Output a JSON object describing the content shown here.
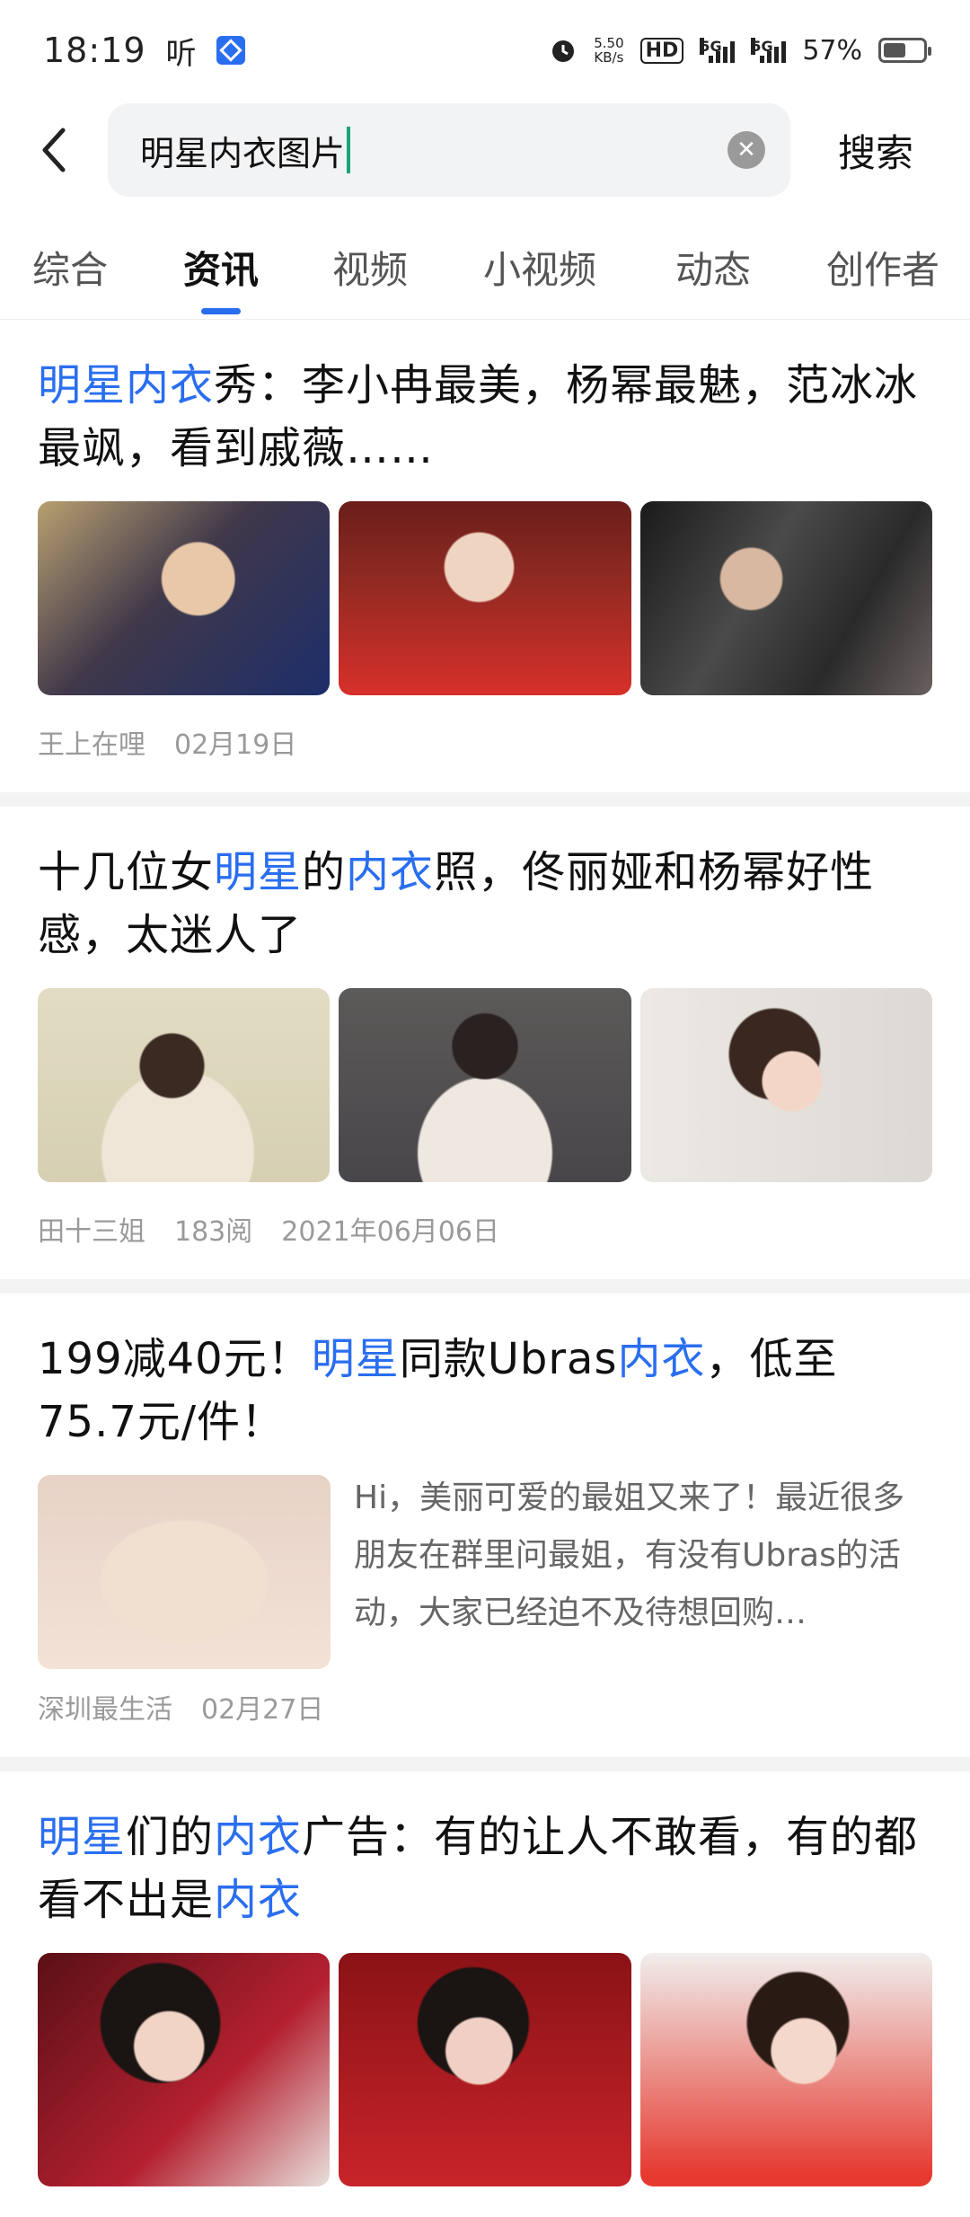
{
  "status_bar": {
    "time": "18:19",
    "listen": "听",
    "speed_value": "5.50",
    "speed_unit": "KB/s",
    "hd": "HD",
    "sig1_label": "5G",
    "sig2_label": "5G",
    "battery_percent": "57%",
    "battery_level": 0.57
  },
  "search": {
    "query": "明星内衣图片",
    "search_button": "搜索"
  },
  "tabs": [
    "综合",
    "资讯",
    "视频",
    "小视频",
    "动态",
    "创作者"
  ],
  "active_tab": "资讯",
  "articles": [
    {
      "title_parts": [
        {
          "text": "明星内衣",
          "hl": true
        },
        {
          "text": "秀：李小冉最美，杨幂最魅，范冰冰最飒，看到戚薇……",
          "hl": false
        }
      ],
      "author": "王上在哩",
      "date": "02月19日"
    },
    {
      "title_parts": [
        {
          "text": "十几位女",
          "hl": false
        },
        {
          "text": "明星",
          "hl": true
        },
        {
          "text": "的",
          "hl": false
        },
        {
          "text": "内衣",
          "hl": true
        },
        {
          "text": "照，佟丽娅和杨幂好性感，太迷人了",
          "hl": false
        }
      ],
      "author": "田十三姐",
      "reads": "183阅",
      "date": "2021年06月06日"
    },
    {
      "title_parts": [
        {
          "text": "199减40元！",
          "hl": false
        },
        {
          "text": "明星",
          "hl": true
        },
        {
          "text": "同款Ubras",
          "hl": false
        },
        {
          "text": "内衣",
          "hl": true
        },
        {
          "text": "，低至75.7元/件！",
          "hl": false
        }
      ],
      "snippet": "Hi，美丽可爱的最姐又来了！最近很多朋友在群里问最姐，有没有Ubras的活动，大家已经迫不及待想回购…",
      "author": "深圳最生活",
      "date": "02月27日"
    },
    {
      "title_parts": [
        {
          "text": "明星",
          "hl": true
        },
        {
          "text": "们的",
          "hl": false
        },
        {
          "text": "内衣",
          "hl": true
        },
        {
          "text": "广告：有的让人不敢看，有的都看不出是",
          "hl": false
        },
        {
          "text": "内衣",
          "hl": true
        }
      ]
    }
  ],
  "colors": {
    "accent": "#2a6ef0",
    "caret": "#1aa37a"
  }
}
